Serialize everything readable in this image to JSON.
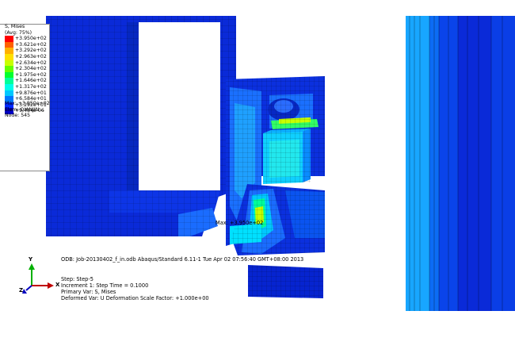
{
  "legend": {
    "title": "S, Mises",
    "subtitle": "(Avg: 75%)",
    "entries": [
      {
        "value": "+3.950e+02",
        "color": "#ff0000"
      },
      {
        "value": "+3.621e+02",
        "color": "#ff6000"
      },
      {
        "value": "+3.292e+02",
        "color": "#ffb000"
      },
      {
        "value": "+2.963e+02",
        "color": "#ffe000"
      },
      {
        "value": "+2.634e+02",
        "color": "#c8ff00"
      },
      {
        "value": "+2.304e+02",
        "color": "#64ff00"
      },
      {
        "value": "+1.975e+02",
        "color": "#00ff30"
      },
      {
        "value": "+1.646e+02",
        "color": "#00ff9a"
      },
      {
        "value": "+1.317e+02",
        "color": "#00ffe8"
      },
      {
        "value": "+9.876e+01",
        "color": "#00c8ff"
      },
      {
        "value": "+6.584e+01",
        "color": "#0078ff"
      },
      {
        "value": "+3.292e+01",
        "color": "#0028ff"
      },
      {
        "value": "+9.484e-06",
        "color": "#0000c8"
      }
    ],
    "max_line": "Max: +3.950e+02",
    "elem_line": "Elem: QIANJIN...",
    "node_line": "Node: 545"
  },
  "annotation": {
    "max_marker": "Max: +3.950e+02"
  },
  "info": {
    "odb_line": "ODB: Job-20130402_f_in.odb    Abaqus/Standard 6.11-1    Tue Apr 02 07:56:40 GMT+08:00 2013",
    "step_line": "Step: Step-5",
    "increment_line": "Increment     1: Step Time =    0.1000",
    "primary_var_line": "Primary Var: S, Mises",
    "deformed_var_line": "Deformed Var: U   Deformation Scale Factor: +1.000e+00"
  },
  "triad": {
    "x_label": "X",
    "y_label": "Y",
    "z_label": "Z"
  }
}
